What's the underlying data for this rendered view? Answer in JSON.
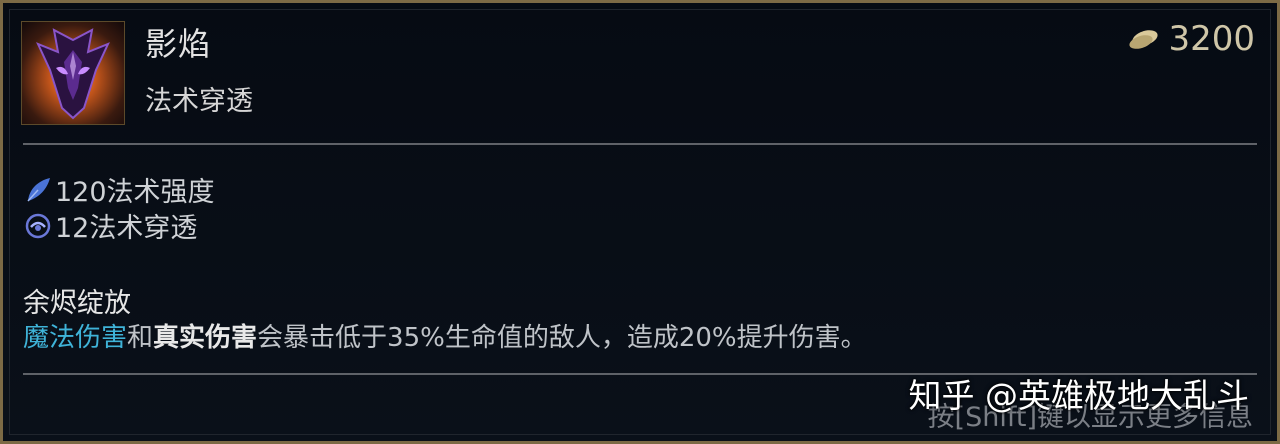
{
  "item": {
    "name": "影焰",
    "tag": "法术穿透",
    "price": "3200",
    "icon": "shadowflame-mask-icon"
  },
  "stats": [
    {
      "text": "120法术强度",
      "icon": "ability-power-icon"
    },
    {
      "text": "12法术穿透",
      "icon": "magic-penetration-icon"
    }
  ],
  "passive": {
    "title": "余烬绽放",
    "desc_magic": "魔法伤害",
    "desc_and": "和",
    "desc_true": "真实伤害",
    "desc_rest": "会暴击低于35%生命值的敌人，造成20%提升伤害。"
  },
  "hint": "按[Shift]键以显示更多信息",
  "watermark": "知乎 @英雄极地大乱斗",
  "colors": {
    "border": "#7c6a45",
    "magic_keyword": "#3fb3d8",
    "gold": "#cfc6a8"
  }
}
